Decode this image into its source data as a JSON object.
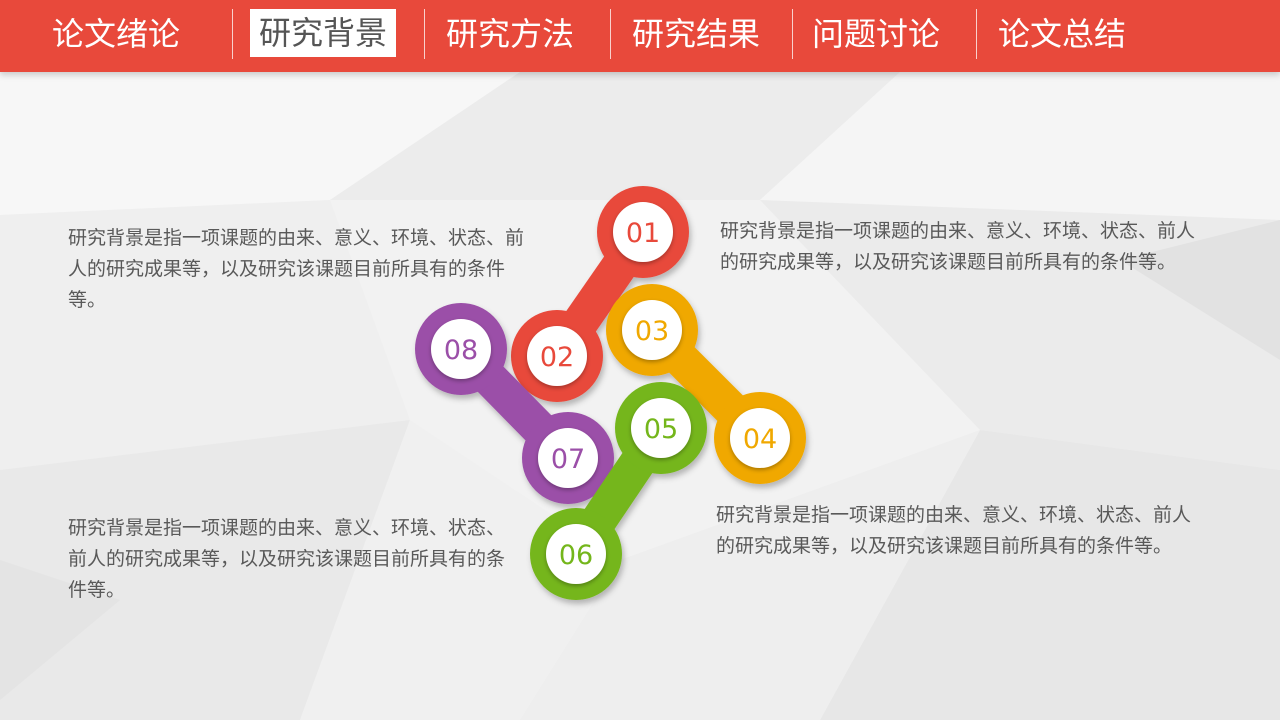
{
  "nav": {
    "items": [
      {
        "label": "论文绪论"
      },
      {
        "label": "研究背景"
      },
      {
        "label": "研究方法"
      },
      {
        "label": "研究结果"
      },
      {
        "label": "问题讨论"
      },
      {
        "label": "论文总结"
      }
    ],
    "active_index": 1,
    "bar_color": "#e8493b"
  },
  "text_blocks": {
    "top_left": "研究背景是指一项课题的由来、意义、环境、状态、前人的研究成果等，以及研究该课题目前所具有的条件等。",
    "top_right": "研究背景是指一项课题的由来、意义、环境、状态、前人的研究成果等，以及研究该课题目前所具有的条件等。",
    "bottom_left": "研究背景是指一项课题的由来、意义、环境、状态、前人的研究成果等，以及研究该课题目前所具有的条件等。",
    "bottom_right": "研究背景是指一项课题的由来、意义、环境、状态、前人的研究成果等，以及研究该课题目前所具有的条件等。"
  },
  "diagram": {
    "nodes": [
      {
        "label": "01",
        "color": "#e8493b"
      },
      {
        "label": "02",
        "color": "#e8493b"
      },
      {
        "label": "03",
        "color": "#f0a800"
      },
      {
        "label": "04",
        "color": "#f0a800"
      },
      {
        "label": "05",
        "color": "#74b61b"
      },
      {
        "label": "06",
        "color": "#74b61b"
      },
      {
        "label": "07",
        "color": "#9b4fa8"
      },
      {
        "label": "08",
        "color": "#9b4fa8"
      }
    ]
  }
}
